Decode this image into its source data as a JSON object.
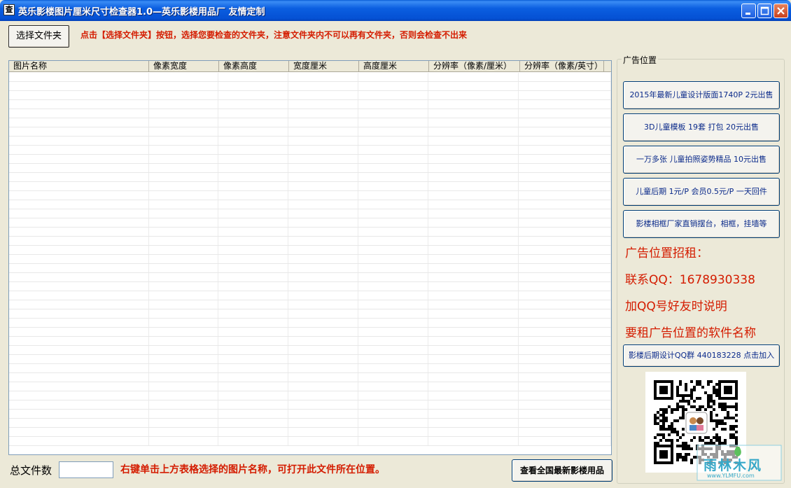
{
  "window": {
    "title": "英乐影楼图片厘米尺寸检查器1.0—英乐影楼用品厂 友情定制",
    "icon_text": "查"
  },
  "toolbar": {
    "select_folder_label": "选择文件夹",
    "instruction": "点击【选择文件夹】按钮，选择您要检查的文件夹，注意文件夹内不可以再有文件夹，否则会检查不出来"
  },
  "table": {
    "columns": [
      "图片名称",
      "像素宽度",
      "像素高度",
      "宽度厘米",
      "高度厘米",
      "分辨率（像素/厘米）",
      "分辨率（像素/英寸）"
    ],
    "rows": []
  },
  "footer": {
    "total_label": "总文件数",
    "total_value": "",
    "hint": "右键单击上方表格选择的图片名称，可打开此文件所在位置。",
    "view_supplies_label": "查看全国最新影楼用品"
  },
  "ads": {
    "group_title": "广告位置",
    "buttons": [
      "2015年最新儿童设计版面1740P  2元出售",
      "3D儿童模板   19套    打包    20元出售",
      "一万多张  儿童拍照姿势精品 10元出售",
      "儿童后期 1元/P  会员0.5元/P  一天回件",
      "影楼相框厂家直销摆台，相框，挂墙等"
    ],
    "lines": [
      "广告位置招租：",
      "联系QQ：1678930338",
      "加QQ号好友时说明",
      "要租广告位置的软件名称"
    ],
    "qq_group_label": "影楼后期设计QQ群  440183228   点击加入"
  },
  "watermark": {
    "text": "雨林木风",
    "url": "www.YLMFU.com"
  },
  "colors": {
    "accent_red": "#d41c00",
    "ad_blue": "#0a2a8a",
    "titlebar": "#0551d4"
  }
}
